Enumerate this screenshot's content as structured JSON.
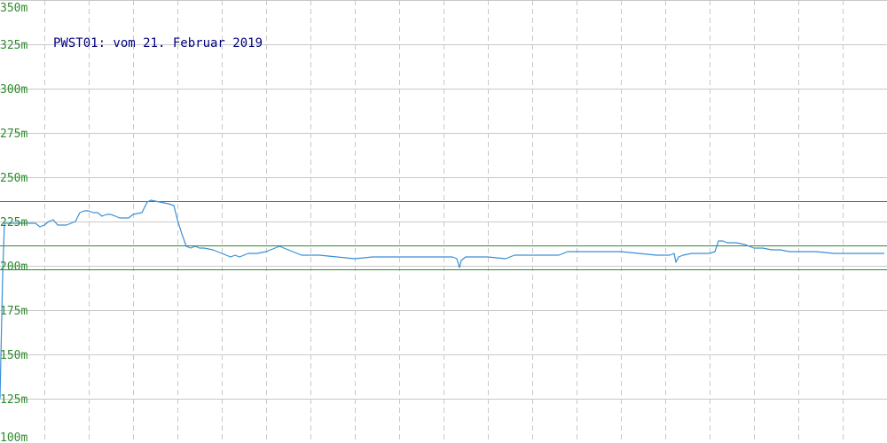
{
  "chart_data": {
    "type": "line",
    "title": "PWST01: vom 21. Februar 2019",
    "ylim": [
      0.1,
      0.35
    ],
    "y_ticks": [
      {
        "value": 0.35,
        "label": "350m"
      },
      {
        "value": 0.325,
        "label": "325m"
      },
      {
        "value": 0.3,
        "label": "300m"
      },
      {
        "value": 0.275,
        "label": "275m"
      },
      {
        "value": 0.25,
        "label": "250m"
      },
      {
        "value": 0.225,
        "label": "225m"
      },
      {
        "value": 0.2,
        "label": "200m"
      },
      {
        "value": 0.175,
        "label": "175m"
      },
      {
        "value": 0.15,
        "label": "150m"
      },
      {
        "value": 0.125,
        "label": "125m"
      },
      {
        "value": 0.1,
        "label": "100m"
      }
    ],
    "x_range": [
      0,
      1
    ],
    "x_gridlines": 20,
    "grid": true,
    "reference_lines": [
      0.2365,
      0.2115,
      0.198
    ],
    "series": [
      {
        "x": [
          0.0,
          0.003,
          0.005,
          0.01,
          0.02,
          0.03,
          0.04,
          0.045,
          0.05,
          0.055,
          0.06,
          0.065,
          0.07,
          0.075,
          0.08,
          0.085,
          0.09,
          0.095,
          0.1,
          0.105,
          0.11,
          0.115,
          0.12,
          0.125,
          0.13,
          0.135,
          0.14,
          0.145,
          0.15,
          0.16,
          0.163,
          0.166,
          0.17,
          0.18,
          0.19,
          0.196,
          0.2,
          0.205,
          0.21,
          0.215,
          0.22,
          0.225,
          0.23,
          0.24,
          0.25,
          0.255,
          0.26,
          0.265,
          0.27,
          0.275,
          0.28,
          0.29,
          0.3,
          0.31,
          0.315,
          0.32,
          0.325,
          0.33,
          0.335,
          0.34,
          0.36,
          0.38,
          0.4,
          0.42,
          0.44,
          0.46,
          0.48,
          0.5,
          0.51,
          0.515,
          0.518,
          0.52,
          0.525,
          0.53,
          0.55,
          0.57,
          0.58,
          0.6,
          0.62,
          0.63,
          0.64,
          0.66,
          0.68,
          0.7,
          0.72,
          0.74,
          0.755,
          0.76,
          0.762,
          0.765,
          0.77,
          0.78,
          0.8,
          0.806,
          0.81,
          0.815,
          0.82,
          0.83,
          0.84,
          0.85,
          0.86,
          0.87,
          0.88,
          0.89,
          0.9,
          0.92,
          0.94,
          0.96,
          0.98,
          0.997
        ],
        "values": [
          0.125,
          0.195,
          0.224,
          0.224,
          0.224,
          0.224,
          0.224,
          0.222,
          0.223,
          0.225,
          0.226,
          0.223,
          0.223,
          0.223,
          0.224,
          0.225,
          0.23,
          0.231,
          0.231,
          0.23,
          0.23,
          0.228,
          0.229,
          0.229,
          0.228,
          0.227,
          0.227,
          0.227,
          0.229,
          0.23,
          0.233,
          0.236,
          0.237,
          0.236,
          0.235,
          0.234,
          0.226,
          0.218,
          0.211,
          0.21,
          0.211,
          0.21,
          0.21,
          0.209,
          0.207,
          0.206,
          0.205,
          0.206,
          0.205,
          0.206,
          0.207,
          0.207,
          0.208,
          0.21,
          0.211,
          0.21,
          0.209,
          0.208,
          0.207,
          0.206,
          0.206,
          0.205,
          0.204,
          0.205,
          0.205,
          0.205,
          0.205,
          0.205,
          0.205,
          0.204,
          0.199,
          0.203,
          0.205,
          0.205,
          0.205,
          0.204,
          0.206,
          0.206,
          0.206,
          0.206,
          0.208,
          0.208,
          0.208,
          0.208,
          0.207,
          0.206,
          0.206,
          0.207,
          0.202,
          0.205,
          0.206,
          0.207,
          0.207,
          0.208,
          0.214,
          0.214,
          0.213,
          0.213,
          0.212,
          0.21,
          0.21,
          0.209,
          0.209,
          0.208,
          0.208,
          0.208,
          0.207,
          0.207,
          0.207,
          0.207
        ]
      }
    ],
    "colors": {
      "line": "#3a8fd6",
      "reference_line": "#2e8b2e",
      "grid": "#c8c8c8",
      "tick_label": "#2e8b2e",
      "title": "#000080"
    }
  }
}
